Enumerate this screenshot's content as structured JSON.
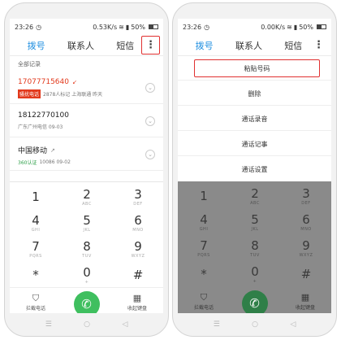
{
  "left_phone": {
    "status": {
      "time": "23:26",
      "speed": "0.53K/s",
      "battery": "50%"
    },
    "tabs": [
      {
        "label": "拨号"
      },
      {
        "label": "联系人"
      },
      {
        "label": "短信"
      }
    ],
    "menu_icon": "more-vertical-icon",
    "section_header": "全部记录",
    "calls": [
      {
        "number": "17077715640",
        "tag": "骚扰电话",
        "meta": "2878人标记 上海联通 昨天",
        "missed": true
      },
      {
        "number": "18122770100",
        "meta": "广东广州电信 09-03",
        "missed": false
      },
      {
        "number": "中国移动",
        "tag": "360认证",
        "meta": "10086 09-02",
        "missed": false
      }
    ],
    "bottom": {
      "block_label": "拦截电话",
      "hide_label": "收起键盘"
    }
  },
  "right_phone": {
    "status": {
      "time": "23:26",
      "speed": "0.00K/s",
      "battery": "50%"
    },
    "tabs": [
      {
        "label": "拨号"
      },
      {
        "label": "联系人"
      },
      {
        "label": "短信"
      }
    ],
    "menu": [
      {
        "label": "粘贴号码"
      },
      {
        "label": "删除"
      },
      {
        "label": "通话录音"
      },
      {
        "label": "通话记事"
      },
      {
        "label": "通话设置"
      }
    ],
    "bottom": {
      "block_label": "拦截电话",
      "hide_label": "收起键盘"
    }
  },
  "keypad": [
    {
      "digit": "1",
      "letters": ""
    },
    {
      "digit": "2",
      "letters": "ABC"
    },
    {
      "digit": "3",
      "letters": "DEF"
    },
    {
      "digit": "4",
      "letters": "GHI"
    },
    {
      "digit": "5",
      "letters": "JKL"
    },
    {
      "digit": "6",
      "letters": "MNO"
    },
    {
      "digit": "7",
      "letters": "PQRS"
    },
    {
      "digit": "8",
      "letters": "TUV"
    },
    {
      "digit": "9",
      "letters": "WXYZ"
    },
    {
      "digit": "*",
      "letters": ""
    },
    {
      "digit": "0",
      "letters": "+"
    },
    {
      "digit": "#",
      "letters": ""
    }
  ],
  "colors": {
    "accent": "#1e8ee0",
    "missed": "#e2391c",
    "call_green": "#3fbf5f",
    "dim_overlay": "#8a8a8a",
    "highlight_box": "#e03030"
  }
}
